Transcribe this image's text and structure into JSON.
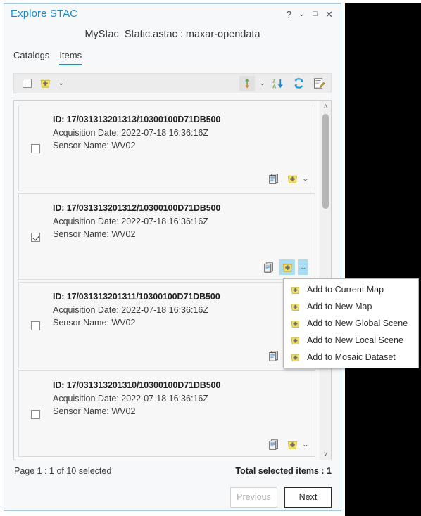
{
  "window": {
    "title": "Explore STAC",
    "controls": [
      {
        "name": "help-button",
        "glyph": "?"
      },
      {
        "name": "menu-button",
        "glyph": "⌄"
      },
      {
        "name": "maximize-button",
        "glyph": "□"
      },
      {
        "name": "close-button",
        "glyph": "✕"
      }
    ],
    "accent_color": "#1a8cc8",
    "border_color": "#9fc5e0"
  },
  "document_title": "MyStac_Static.astac : maxar-opendata",
  "tabs": [
    {
      "label": "Catalogs",
      "active": false
    },
    {
      "label": "Items",
      "active": true
    }
  ],
  "toolbar": {
    "select_all_checked": false,
    "add_to_map_icon": "add-to-map-icon",
    "add_dropdown_icon": "chevron-down-icon",
    "sort_direction_icon": "sort-ascending-descending-icon",
    "sort_direction_dropdown_icon": "chevron-down-icon",
    "sort_az_icon": "sort-z-to-a-icon",
    "refresh_icon": "refresh-icon",
    "edit_metadata_icon": "edit-metadata-icon"
  },
  "items": [
    {
      "id_label": "ID: 17/031313201313/10300100D71DB500",
      "acquisition": "Acquisition Date: 2022-07-18 16:36:16Z",
      "sensor": "Sensor Name: WV02",
      "checked": false,
      "add_highlighted": false
    },
    {
      "id_label": "ID: 17/031313201312/10300100D71DB500",
      "acquisition": "Acquisition Date: 2022-07-18 16:36:16Z",
      "sensor": "Sensor Name: WV02",
      "checked": true,
      "add_highlighted": true
    },
    {
      "id_label": "ID: 17/031313201311/10300100D71DB500",
      "acquisition": "Acquisition Date: 2022-07-18 16:36:16Z",
      "sensor": "Sensor Name: WV02",
      "checked": false,
      "add_highlighted": false
    },
    {
      "id_label": "ID: 17/031313201310/10300100D71DB500",
      "acquisition": "Acquisition Date: 2022-07-18 16:36:16Z",
      "sensor": "Sensor Name: WV02",
      "checked": false,
      "add_highlighted": false
    }
  ],
  "item_actions": {
    "metadata_icon": "view-metadata-icon",
    "add_icon": "add-to-map-icon",
    "dropdown_icon": "chevron-down-icon"
  },
  "menu": {
    "open": true,
    "items": [
      {
        "label": "Add to Current  Map",
        "icon": "add-to-map-icon"
      },
      {
        "label": "Add to New Map",
        "icon": "add-to-map-icon"
      },
      {
        "label": "Add to New Global Scene",
        "icon": "add-to-map-icon"
      },
      {
        "label": "Add to New Local Scene",
        "icon": "add-to-map-icon"
      },
      {
        "label": "Add to Mosaic Dataset",
        "icon": "add-to-map-icon"
      }
    ]
  },
  "footer": {
    "page_status": "Page 1 : 1 of 10 selected",
    "total_selected": "Total selected items : 1",
    "previous_label": "Previous",
    "previous_disabled": true,
    "next_label": "Next"
  },
  "scrollbar": {
    "up_glyph": "˄",
    "down_glyph": "˅"
  },
  "colors": {
    "title_blue": "#1a8cc8",
    "tab_underline": "#1f8ac0",
    "selection_blue": "#aadcf2",
    "icon_yellow": "#f2e06a",
    "toolbar_bg": "#ececec"
  }
}
